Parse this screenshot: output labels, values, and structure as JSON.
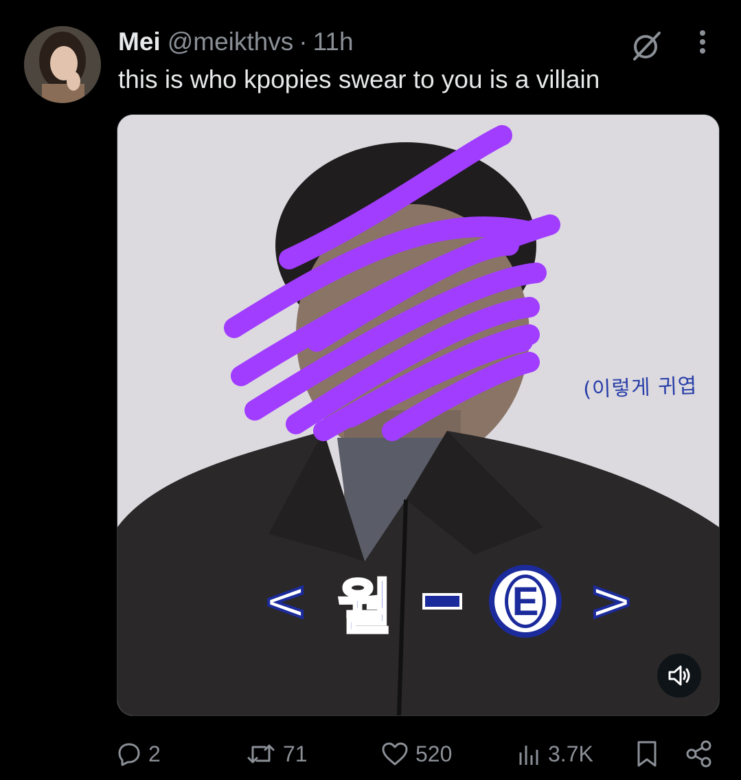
{
  "tweet": {
    "author_name": "Mei",
    "author_handle": "@meikthvs",
    "separator": "·",
    "timestamp": "11h",
    "text": "this is who kpopies swear to you is a villain"
  },
  "media": {
    "subtitle_overlay": "(이렇게 귀엽",
    "caption_left": "<",
    "caption_word": "월",
    "caption_letter": "E",
    "caption_right": ">",
    "mute_icon": "speaker-muted-icon"
  },
  "actions": {
    "replies": "2",
    "reposts": "71",
    "likes": "520",
    "views": "3.7K"
  },
  "colors": {
    "background": "#000000",
    "text_primary": "#e7e9ea",
    "text_secondary": "#8b9097",
    "scribble": "#a13dff",
    "caption_blue": "#1c3ec2"
  }
}
